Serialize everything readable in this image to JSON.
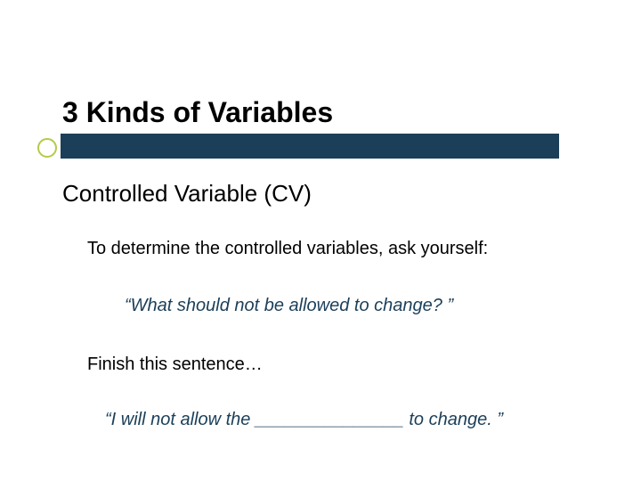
{
  "slide": {
    "title": "3 Kinds of Variables",
    "subtitle": "Controlled Variable (CV)",
    "body1": "To determine the controlled variables, ask yourself:",
    "quote1": "“What should not be allowed to change? ”",
    "body2": "Finish this sentence…",
    "quote2": "“I will not allow the _______________ to change. ”"
  },
  "colors": {
    "bar": "#1b3f59",
    "bullet_ring": "#b6c94a",
    "quote": "#1b3f59"
  }
}
